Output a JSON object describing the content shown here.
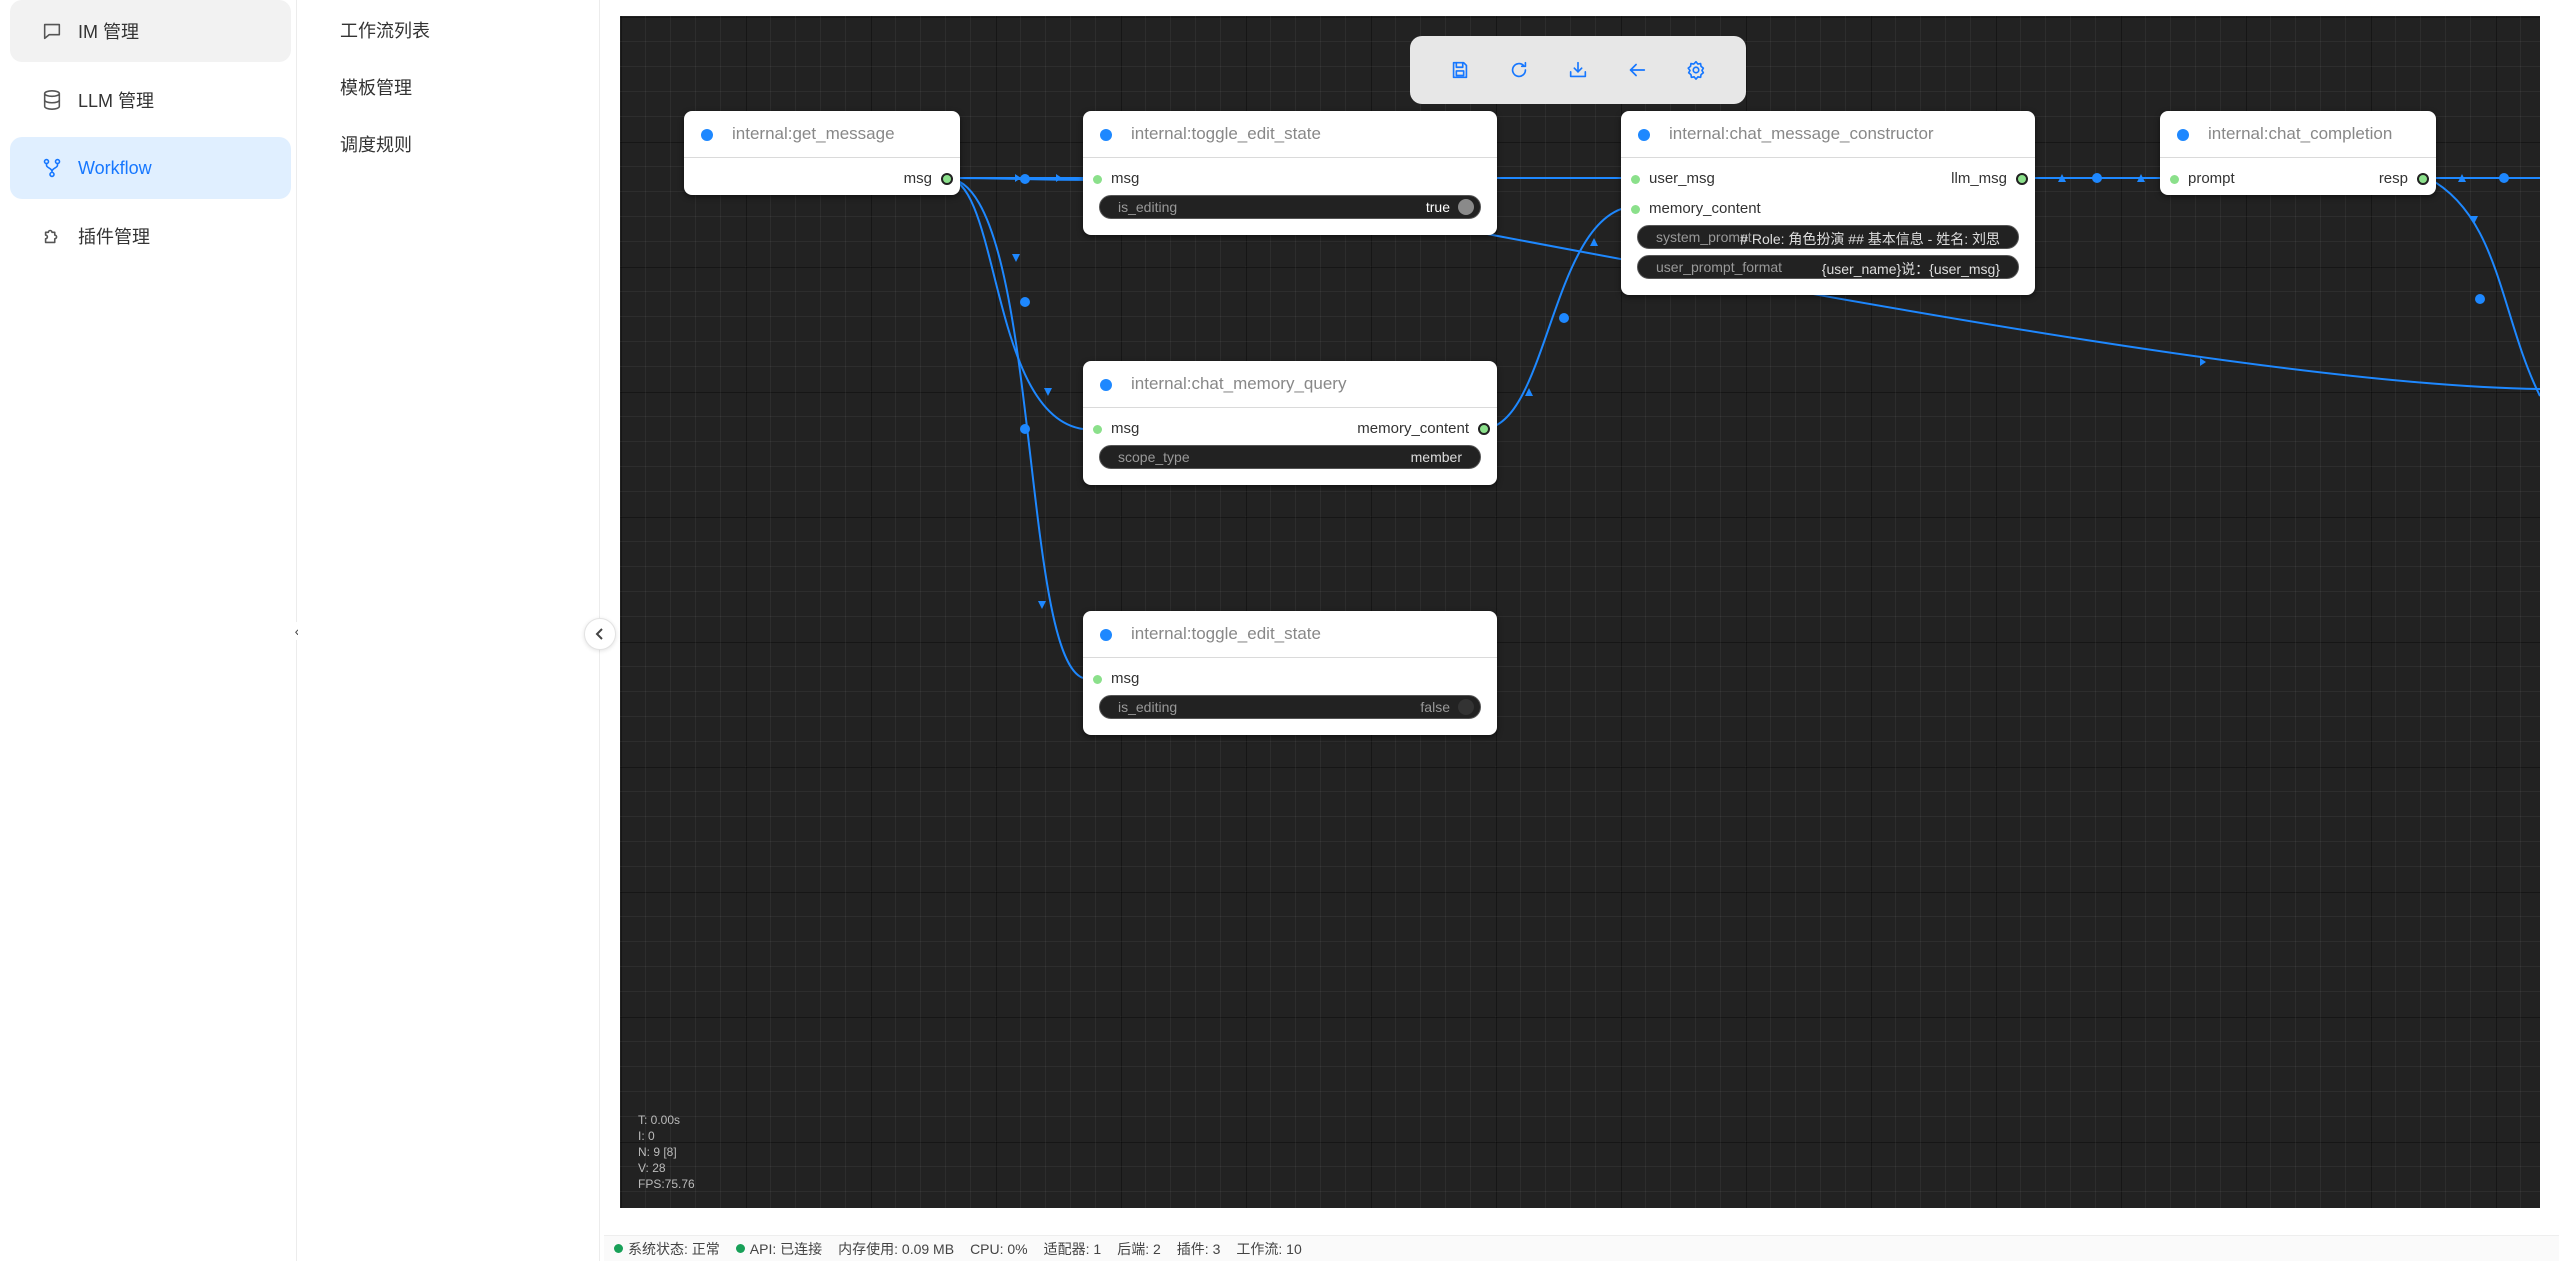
{
  "sidebar": {
    "items": [
      {
        "label": "IM 管理",
        "icon": "message-square-icon"
      },
      {
        "label": "LLM 管理",
        "icon": "database-icon"
      },
      {
        "label": "Workflow",
        "icon": "git-branch-icon"
      },
      {
        "label": "插件管理",
        "icon": "puzzle-icon"
      }
    ],
    "collapse_glyph": "‹"
  },
  "submenu": {
    "items": [
      {
        "label": "工作流列表"
      },
      {
        "label": "模板管理"
      },
      {
        "label": "调度规则"
      }
    ]
  },
  "toolbar": {
    "buttons": [
      "save-icon",
      "refresh-icon",
      "import-icon",
      "back-arrow-icon",
      "settings-icon"
    ]
  },
  "accent_color": "#1677ff",
  "edge_color": "#1e88ff",
  "nodes": {
    "get_message": {
      "title": "internal:get_message",
      "out": "msg"
    },
    "toggle_true": {
      "title": "internal:toggle_edit_state",
      "in": "msg",
      "widget_name": "is_editing",
      "widget_value": "true"
    },
    "memory_query": {
      "title": "internal:chat_memory_query",
      "in": "msg",
      "out": "memory_content",
      "widget_name": "scope_type",
      "widget_value": "member"
    },
    "toggle_false": {
      "title": "internal:toggle_edit_state",
      "in": "msg",
      "widget_name": "is_editing",
      "widget_value": "false"
    },
    "constructor": {
      "title": "internal:chat_message_constructor",
      "in1": "user_msg",
      "in2": "memory_content",
      "out": "llm_msg",
      "w1_name": "system_prompt",
      "w1_value": "# Role: 角色扮演  ## 基本信息 - 姓名: 刘思",
      "w2_name": "user_prompt_format",
      "w2_value": "{user_name}说：{user_msg}"
    },
    "completion": {
      "title": "internal:chat_completion",
      "in": "prompt",
      "out": "resp"
    }
  },
  "stats": {
    "t": "T: 0.00s",
    "i": "I: 0",
    "n": "N: 9 [8]",
    "v": "V: 28",
    "fps": "FPS:75.76"
  },
  "statusbar": {
    "system": "系统状态: 正常",
    "api": "API: 已连接",
    "memory": "内存使用: 0.09 MB",
    "cpu": "CPU: 0%",
    "adapters": "适配器: 1",
    "backends": "后端: 2",
    "plugins": "插件: 3",
    "workflows": "工作流: 10",
    "status_color": "#18a058"
  }
}
